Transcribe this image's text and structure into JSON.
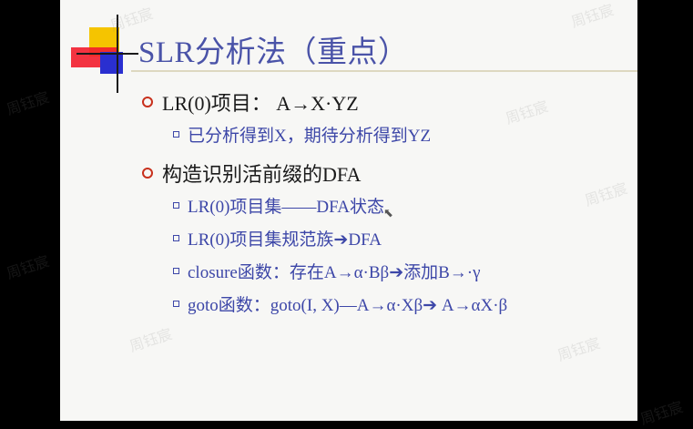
{
  "slide": {
    "title": "SLR分析法（重点）",
    "items": [
      {
        "level": 1,
        "text": "LR(0)项目：  A→X·YZ"
      },
      {
        "level": 2,
        "text": "已分析得到X，期待分析得到YZ"
      },
      {
        "level": 1,
        "text": "构造识别活前缀的DFA"
      },
      {
        "level": 2,
        "text": "LR(0)项目集——DFA状态"
      },
      {
        "level": 2,
        "text": "LR(0)项目集规范族➔DFA"
      },
      {
        "level": 2,
        "text": "closure函数：存在A→α·Bβ➔添加B→·γ"
      },
      {
        "level": 2,
        "text": "goto函数：goto(I, X)—A→α·Xβ➔ A→αX·β"
      }
    ]
  },
  "watermark": {
    "text": "周钰宸"
  },
  "colors": {
    "background": "#000000",
    "slide": "#f7f7f5",
    "title": "#4a53a8",
    "level1_text": "#1a1a1a",
    "level2_text": "#3d47a8",
    "bullet_circle": "#c8301c"
  }
}
